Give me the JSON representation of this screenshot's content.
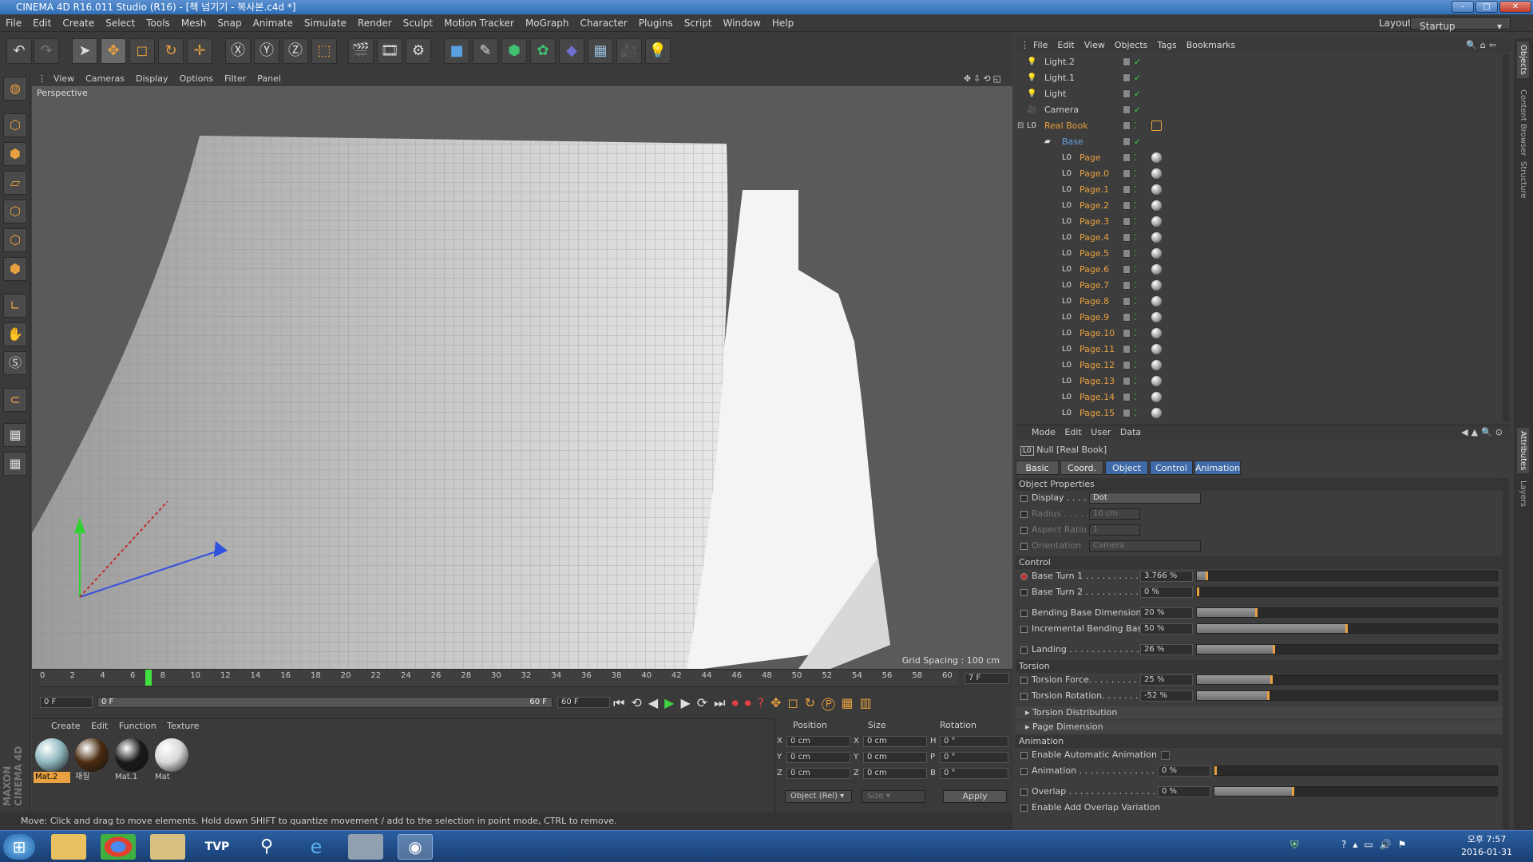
{
  "window": {
    "title": "CINEMA 4D R16.011 Studio (R16) - [책 넘기기 - 복사본.c4d *]"
  },
  "menu": [
    "File",
    "Edit",
    "Create",
    "Select",
    "Tools",
    "Mesh",
    "Snap",
    "Animate",
    "Simulate",
    "Render",
    "Sculpt",
    "Motion Tracker",
    "MoGraph",
    "Character",
    "Plugins",
    "Script",
    "Window",
    "Help"
  ],
  "layout": {
    "label": "Layout:",
    "value": "Startup"
  },
  "viewport": {
    "menu": [
      "View",
      "Cameras",
      "Display",
      "Options",
      "Filter",
      "Panel"
    ],
    "name": "Perspective",
    "grid_spacing": "Grid Spacing : 100 cm"
  },
  "timeline": {
    "ticks": [
      "0",
      "2",
      "4",
      "6",
      "8",
      "10",
      "12",
      "14",
      "16",
      "18",
      "20",
      "22",
      "24",
      "26",
      "28",
      "30",
      "32",
      "34",
      "36",
      "38",
      "40",
      "42",
      "44",
      "46",
      "48",
      "50",
      "52",
      "54",
      "56",
      "58",
      "60"
    ],
    "current_frame": "7",
    "frame_display": "7 F",
    "start": "0 F",
    "range_start": "0 F",
    "range_end": "60 F",
    "end": "60 F"
  },
  "materials": {
    "menu": [
      "Create",
      "Edit",
      "Function",
      "Texture"
    ],
    "items": [
      {
        "label": "Mat.2",
        "color": "#8fb8c0",
        "selected": true
      },
      {
        "label": "재질",
        "color": "#4a2c10",
        "selected": false
      },
      {
        "label": "Mat.1",
        "color": "#1a1a1a",
        "selected": false
      },
      {
        "label": "Mat",
        "color": "#d8d8d8",
        "selected": false
      }
    ]
  },
  "coords": {
    "headers": [
      "Position",
      "Size",
      "Rotation"
    ],
    "rows": [
      {
        "a": "X",
        "pos": "0 cm",
        "b": "X",
        "size": "0 cm",
        "c": "H",
        "rot": "0 °"
      },
      {
        "a": "Y",
        "pos": "0 cm",
        "b": "Y",
        "size": "0 cm",
        "c": "P",
        "rot": "0 °"
      },
      {
        "a": "Z",
        "pos": "0 cm",
        "b": "Z",
        "size": "0 cm",
        "c": "B",
        "rot": "0 °"
      }
    ],
    "mode": "Object (Rel)",
    "size_mode": "Size",
    "apply": "Apply"
  },
  "status": "Move: Click and drag to move elements. Hold down SHIFT to quantize movement / add to the selection in point mode, CTRL to remove.",
  "objects": {
    "menu": [
      "File",
      "Edit",
      "View",
      "Objects",
      "Tags",
      "Bookmarks"
    ],
    "items": [
      {
        "name": "Light.2",
        "type": "light",
        "indent": 0
      },
      {
        "name": "Light.1",
        "type": "light",
        "indent": 0
      },
      {
        "name": "Light",
        "type": "light",
        "indent": 0
      },
      {
        "name": "Camera",
        "type": "camera",
        "indent": 0
      },
      {
        "name": "Real Book",
        "type": "null",
        "indent": 0
      },
      {
        "name": "Base",
        "type": "base",
        "indent": 1
      },
      {
        "name": "Page",
        "type": "null",
        "indent": 2
      },
      {
        "name": "Page.0",
        "type": "null",
        "indent": 2
      },
      {
        "name": "Page.1",
        "type": "null",
        "indent": 2
      },
      {
        "name": "Page.2",
        "type": "null",
        "indent": 2
      },
      {
        "name": "Page.3",
        "type": "null",
        "indent": 2
      },
      {
        "name": "Page.4",
        "type": "null",
        "indent": 2
      },
      {
        "name": "Page.5",
        "type": "null",
        "indent": 2
      },
      {
        "name": "Page.6",
        "type": "null",
        "indent": 2
      },
      {
        "name": "Page.7",
        "type": "null",
        "indent": 2
      },
      {
        "name": "Page.8",
        "type": "null",
        "indent": 2
      },
      {
        "name": "Page.9",
        "type": "null",
        "indent": 2
      },
      {
        "name": "Page.10",
        "type": "null",
        "indent": 2
      },
      {
        "name": "Page.11",
        "type": "null",
        "indent": 2
      },
      {
        "name": "Page.12",
        "type": "null",
        "indent": 2
      },
      {
        "name": "Page.13",
        "type": "null",
        "indent": 2
      },
      {
        "name": "Page.14",
        "type": "null",
        "indent": 2
      },
      {
        "name": "Page.15",
        "type": "null",
        "indent": 2
      }
    ]
  },
  "attributes": {
    "menu": [
      "Mode",
      "Edit",
      "User Data"
    ],
    "object_title": "Null [Real Book]",
    "tabs": [
      "Basic",
      "Coord.",
      "Object",
      "Control",
      "Animation"
    ],
    "active_tabs": [
      "Object",
      "Control",
      "Animation"
    ],
    "object_props": {
      "header": "Object Properties",
      "display_label": "Display . . . . .",
      "display_value": "Dot",
      "radius_label": "Radius . . . . .",
      "radius_value": "10 cm",
      "aspect_label": "Aspect Ratio",
      "aspect_value": "1",
      "orient_label": "Orientation",
      "orient_value": "Camera"
    },
    "control": {
      "header": "Control",
      "params": [
        {
          "label": "Base Turn 1 . . . . . . . . . . .",
          "value": "3.766 %",
          "fraction": 0.038
        },
        {
          "label": "Base Turn 2 . . . . . . . . . . .",
          "value": "0 %",
          "fraction": 0.0
        },
        {
          "label": "Bending Base Dimension",
          "value": "20 %",
          "fraction": 0.2
        },
        {
          "label": "Incremental Bending Base",
          "value": "50 %",
          "fraction": 0.5
        },
        {
          "label": "Landing . . . . . . . . . . . . . . .",
          "value": "26 %",
          "fraction": 0.26
        }
      ]
    },
    "torsion": {
      "header": "Torsion",
      "params": [
        {
          "label": "Torsion Force. . . . . . . . . .",
          "value": "25 %",
          "fraction": 0.25
        },
        {
          "label": "Torsion Rotation. . . . . . .",
          "value": "-52 %",
          "fraction": 0.24
        }
      ],
      "groups": [
        "Torsion Distribution",
        "Page Dimension"
      ]
    },
    "animation": {
      "header": "Animation",
      "enable_auto": "Enable Automatic Animation",
      "params": [
        {
          "label": "Animation . . . . . . . . . . . . . . .",
          "value": "0 %",
          "fraction": 0.0
        },
        {
          "label": "Overlap . . . . . . . . . . . . . . . . .",
          "value": "0 %",
          "fraction": 0.28
        }
      ],
      "cut_label": "Enable Add Overlap Variation"
    }
  },
  "side_tabs": [
    "Objects",
    "Content Browser",
    "Structure",
    "Attributes",
    "Layers"
  ],
  "left_branding": "MAXON CINEMA 4D",
  "taskbar": {
    "time": "오후 7:57",
    "date": "2016-01-31",
    "tvp": "TVP"
  }
}
